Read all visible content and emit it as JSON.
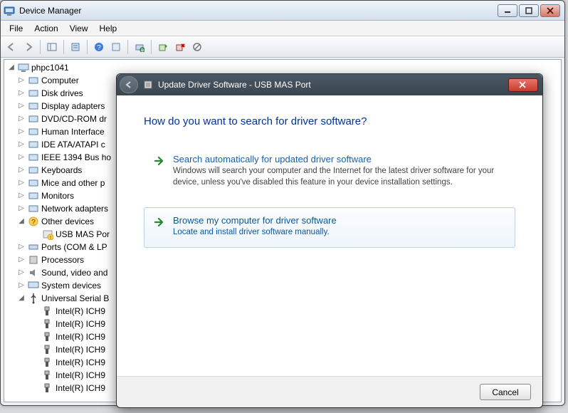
{
  "dm": {
    "title": "Device Manager",
    "menu": {
      "file": "File",
      "action": "Action",
      "view": "View",
      "help": "Help"
    },
    "tree": {
      "root": "phpc1041",
      "nodes": [
        "Computer",
        "Disk drives",
        "Display adapters",
        "DVD/CD-ROM dr",
        "Human Interface",
        "IDE ATA/ATAPI c",
        "IEEE 1394 Bus ho",
        "Keyboards",
        "Mice and other p",
        "Monitors",
        "Network adapters"
      ],
      "other_devices": "Other devices",
      "usb_mas": "USB MAS Por",
      "ports": "Ports (COM & LP",
      "processors": "Processors",
      "sound": "Sound, video and",
      "system": "System devices",
      "usb_ctrl": "Universal Serial B",
      "ich9_items": [
        "Intel(R) ICH9",
        "Intel(R) ICH9",
        "Intel(R) ICH9",
        "Intel(R) ICH9",
        "Intel(R) ICH9",
        "Intel(R) ICH9",
        "Intel(R) ICH9"
      ]
    }
  },
  "wizard": {
    "title": "Update Driver Software - USB MAS Port",
    "heading": "How do you want to search for driver software?",
    "opt1": {
      "title": "Search automatically for updated driver software",
      "desc": "Windows will search your computer and the Internet for the latest driver software for your device, unless you've disabled this feature in your device installation settings."
    },
    "opt2": {
      "title": "Browse my computer for driver software",
      "desc": "Locate and install driver software manually."
    },
    "cancel": "Cancel"
  }
}
